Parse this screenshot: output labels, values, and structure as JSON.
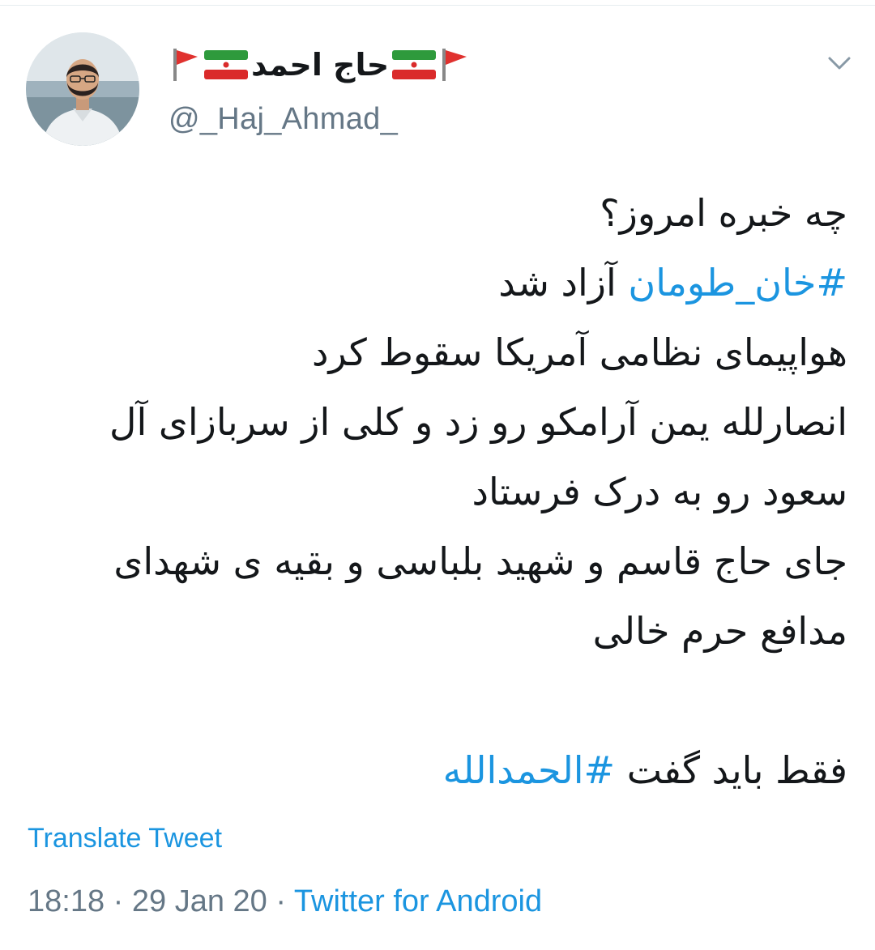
{
  "author": {
    "display_name": "حاج احمد",
    "handle": "@_Haj_Ahmad_",
    "flag_icon": "red-flag-icon",
    "iran_flag_icon": "iran-flag-icon"
  },
  "tweet": {
    "line1": "چه خبره امروز؟",
    "line2_hashtag": "#خان_طومان",
    "line2_text": " آزاد شد",
    "line3": "هواپیمای نظامی آمریکا سقوط کرد",
    "line4": "انصارلله یمن آرامکو رو زد و کلی از سربازای آل",
    "line5": "سعود رو به درک فرستاد",
    "line6": "جای حاج قاسم و شهید بلباسی و بقیه ی شهدای",
    "line7": "مدافع حرم خالی",
    "line8_text": "فقط باید گفت ",
    "line8_hashtag": "#الحمدالله"
  },
  "actions": {
    "translate_label": "Translate Tweet"
  },
  "meta": {
    "time": "18:18",
    "separator": " · ",
    "date": "29 Jan 20",
    "source": "Twitter for Android"
  },
  "colors": {
    "link": "#1b95e0",
    "secondary": "#657786",
    "text": "#14171a"
  }
}
